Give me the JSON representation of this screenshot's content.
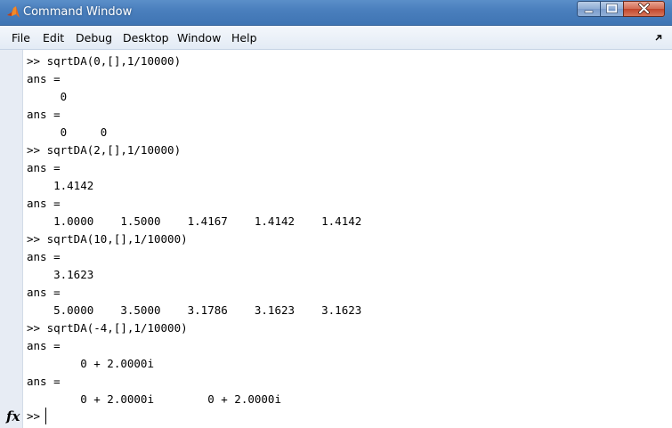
{
  "window": {
    "title": "Command Window",
    "accent": "#4a7fbd",
    "close_color": "#c2452b"
  },
  "menu": {
    "items": [
      "File",
      "Edit",
      "Debug",
      "Desktop",
      "Window",
      "Help"
    ]
  },
  "icons": {
    "app": "matlab-logo-icon",
    "minimize": "minimize-icon",
    "maximize": "maximize-icon",
    "close": "close-icon",
    "undock": "undock-arrow-icon",
    "function_browser": "fx-icon"
  },
  "command_window": {
    "lines": [
      ">> sqrtDA(0,[],1/10000)",
      "ans =",
      "     0",
      "ans =",
      "     0     0",
      ">> sqrtDA(2,[],1/10000)",
      "ans =",
      "    1.4142",
      "ans =",
      "    1.0000    1.5000    1.4167    1.4142    1.4142",
      ">> sqrtDA(10,[],1/10000)",
      "ans =",
      "    3.1623",
      "ans =",
      "    5.0000    3.5000    3.1786    3.1623    3.1623",
      ">> sqrtDA(-4,[],1/10000)",
      "ans =",
      "        0 + 2.0000i",
      "ans =",
      "        0 + 2.0000i        0 + 2.0000i"
    ],
    "prompt": ">>",
    "fx_label": "fx"
  }
}
